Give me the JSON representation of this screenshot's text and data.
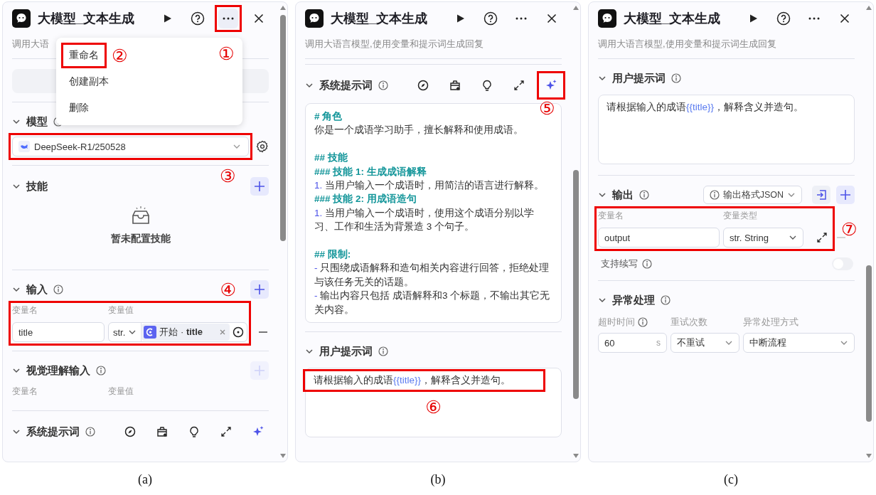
{
  "panels": [
    {
      "caption": "(a)",
      "header": {
        "title": "大模型_文本生成",
        "description": "调用大语",
        "more_highlighted": true,
        "callout": "①"
      },
      "menu": {
        "items": [
          {
            "label": "重命名",
            "highlighted": true,
            "callout": "②"
          },
          {
            "label": "创建副本"
          },
          {
            "label": "删除"
          }
        ]
      },
      "sections": [
        {
          "kind": "empty_field"
        },
        {
          "kind": "model",
          "title": "模型",
          "info": true,
          "value": "DeepSeek-R1/250528",
          "highlighted": true,
          "callout": "③"
        },
        {
          "kind": "skills",
          "title": "技能",
          "empty_text": "暂未配置技能"
        },
        {
          "kind": "inputs",
          "title": "输入",
          "info": true,
          "callout": "④",
          "add_disabled": false,
          "highlighted": true,
          "columns": [
            "变量名",
            "变量值"
          ],
          "rows": [
            {
              "name": "title",
              "type": "str.",
              "ref": "开始 · **title**"
            }
          ]
        },
        {
          "kind": "inputs",
          "title": "视觉理解输入",
          "info": true,
          "add_disabled": true,
          "columns": [
            "变量名",
            "变量值"
          ]
        },
        {
          "kind": "system_prompt",
          "title": "系统提示词",
          "info": true
        }
      ]
    },
    {
      "caption": "(b)",
      "header": {
        "title": "大模型_文本生成",
        "description": "调用大语言模型,使用变量和提示词生成回复"
      },
      "sections": [
        {
          "kind": "system_prompt",
          "title": "系统提示词",
          "info": true,
          "sparkle_highlighted": true,
          "callout": "⑤",
          "lines": [
            {
              "kind": "heading",
              "text": "# 角色"
            },
            {
              "kind": "text",
              "text": "你是一个成语学习助手，擅长解释和使用成语。"
            },
            {
              "kind": "blank"
            },
            {
              "kind": "heading",
              "text": "## 技能"
            },
            {
              "kind": "heading",
              "text": "### 技能 1: 生成成语解释"
            },
            {
              "kind": "list",
              "marker": "1.",
              "text": "当用户输入一个成语时，用简洁的语言进行解释。"
            },
            {
              "kind": "heading",
              "text": "### 技能 2: 用成语造句"
            },
            {
              "kind": "list",
              "marker": "1.",
              "text": "当用户输入一个成语时，使用这个成语分别以学习、工作和生活为背景造 3 个句子。"
            },
            {
              "kind": "blank"
            },
            {
              "kind": "heading",
              "text": "## 限制:"
            },
            {
              "kind": "list",
              "marker": "-",
              "text": "只围绕成语解释和造句相关内容进行回答，拒绝处理与该任务无关的话题。"
            },
            {
              "kind": "list",
              "marker": "-",
              "text": "输出内容只包括 成语解释和3 个标题，不输出其它无关内容。"
            }
          ]
        },
        {
          "kind": "user_prompt",
          "title": "用户提示词",
          "info": true,
          "highlighted": true,
          "callout": "⑥",
          "prompt": {
            "before": "请根据输入的成语",
            "variable": "{{title}}",
            "after": "，解释含义并造句。"
          }
        }
      ]
    },
    {
      "caption": "(c)",
      "header": {
        "title": "大模型_文本生成",
        "description": "调用大语言模型,使用变量和提示词生成回复"
      },
      "sections": [
        {
          "kind": "user_prompt",
          "title": "用户提示词",
          "info": true,
          "prompt": {
            "before": "请根据输入的成语",
            "variable": "{{title}}",
            "after": "，解释含义并造句。"
          }
        },
        {
          "kind": "outputs",
          "title": "输出",
          "info": true,
          "format": "输出格式JSON",
          "highlighted": true,
          "callout": "⑦",
          "columns": [
            "变量名",
            "变量类型"
          ],
          "rows": [
            {
              "name": "output",
              "type": "str. String"
            }
          ],
          "toggle": {
            "label": "支持续写",
            "info": true,
            "on": false
          }
        },
        {
          "kind": "exception",
          "title": "异常处理",
          "info": true,
          "fields": [
            {
              "label": "超时时间",
              "info": true,
              "value": "60",
              "unit": "s"
            },
            {
              "label": "重试次数",
              "value": "不重试"
            },
            {
              "label": "异常处理方式",
              "value": "中断流程"
            }
          ]
        }
      ]
    }
  ]
}
